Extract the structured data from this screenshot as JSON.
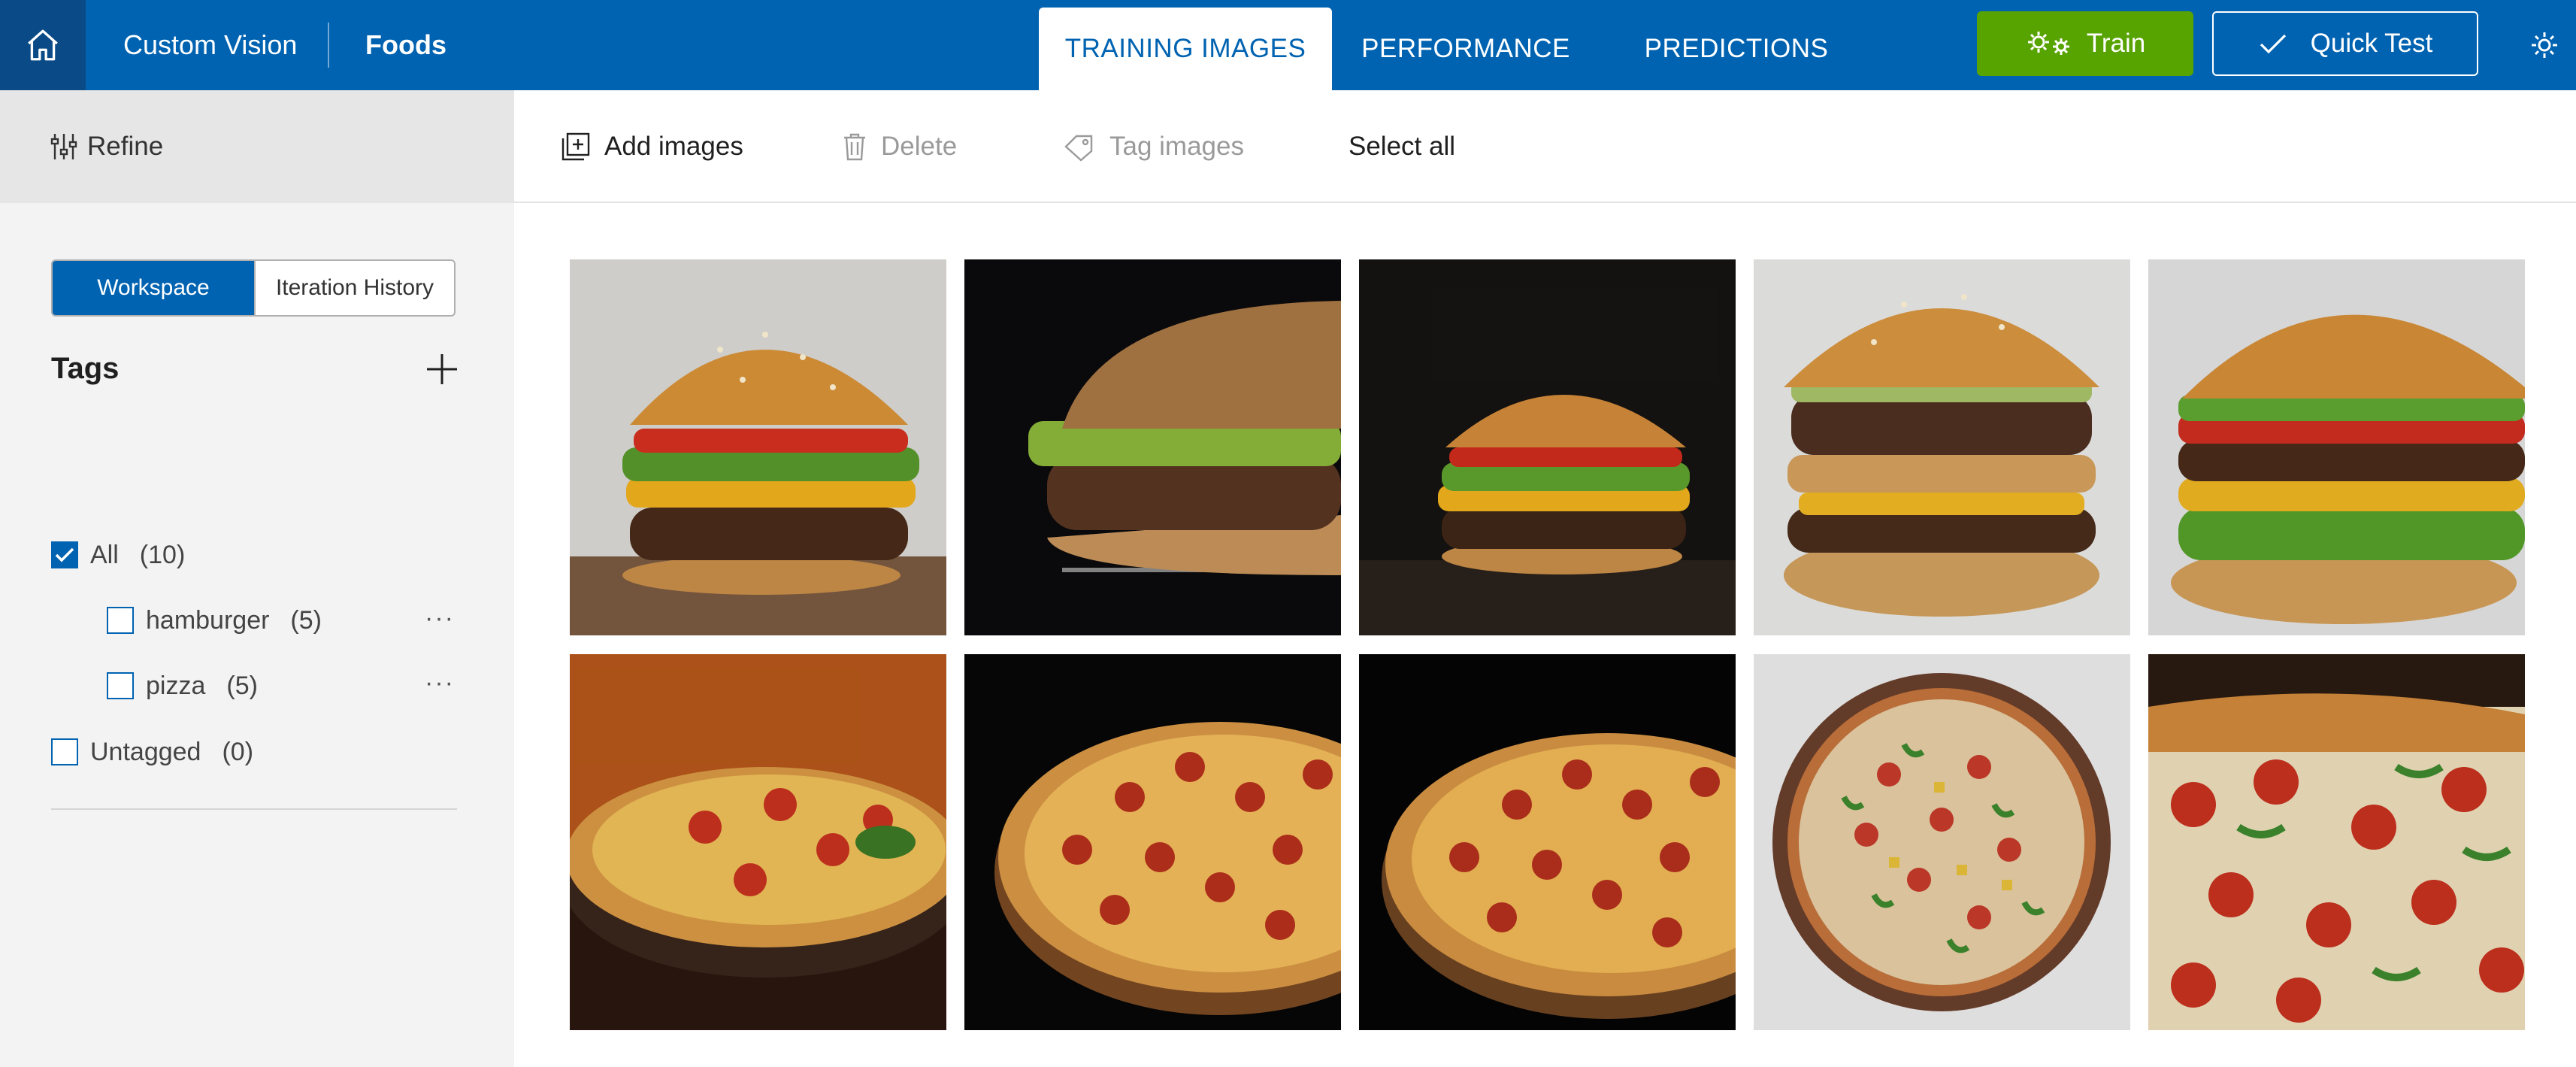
{
  "header": {
    "app_name": "Custom Vision",
    "project_name": "Foods",
    "tabs": [
      {
        "label": "TRAINING IMAGES",
        "active": true
      },
      {
        "label": "PERFORMANCE",
        "active": false
      },
      {
        "label": "PREDICTIONS",
        "active": false
      }
    ],
    "train_label": "Train",
    "quick_test_label": "Quick Test",
    "accent_color": "#0063b1",
    "train_color": "#57a300"
  },
  "toolbar": {
    "add_images": "Add images",
    "delete": "Delete",
    "tag_images": "Tag images",
    "select_all": "Select all"
  },
  "sidebar": {
    "refine_label": "Refine",
    "view_toggle": {
      "workspace": "Workspace",
      "iteration_history": "Iteration History",
      "selected": "Workspace"
    },
    "tags_heading": "Tags",
    "tags": [
      {
        "name": "All",
        "count": "(10)",
        "checked": true
      },
      {
        "name": "hamburger",
        "count": "(5)",
        "checked": false
      },
      {
        "name": "pizza",
        "count": "(5)",
        "checked": false
      },
      {
        "name": "Untagged",
        "count": "(0)",
        "checked": false
      }
    ]
  },
  "images": [
    {
      "subject": "hamburger"
    },
    {
      "subject": "hamburger"
    },
    {
      "subject": "hamburger"
    },
    {
      "subject": "hamburger"
    },
    {
      "subject": "hamburger"
    },
    {
      "subject": "pizza"
    },
    {
      "subject": "pizza"
    },
    {
      "subject": "pizza"
    },
    {
      "subject": "pizza"
    },
    {
      "subject": "pizza"
    }
  ],
  "icons": {
    "home": "home-icon",
    "train": "gears-icon",
    "quick_test": "checkmark-icon",
    "settings": "gear-icon",
    "refine": "sliders-icon",
    "add_images": "add-image-icon",
    "delete": "trash-icon",
    "tag_images": "tag-icon",
    "add_tag": "plus-icon",
    "more": "ellipsis-icon"
  }
}
